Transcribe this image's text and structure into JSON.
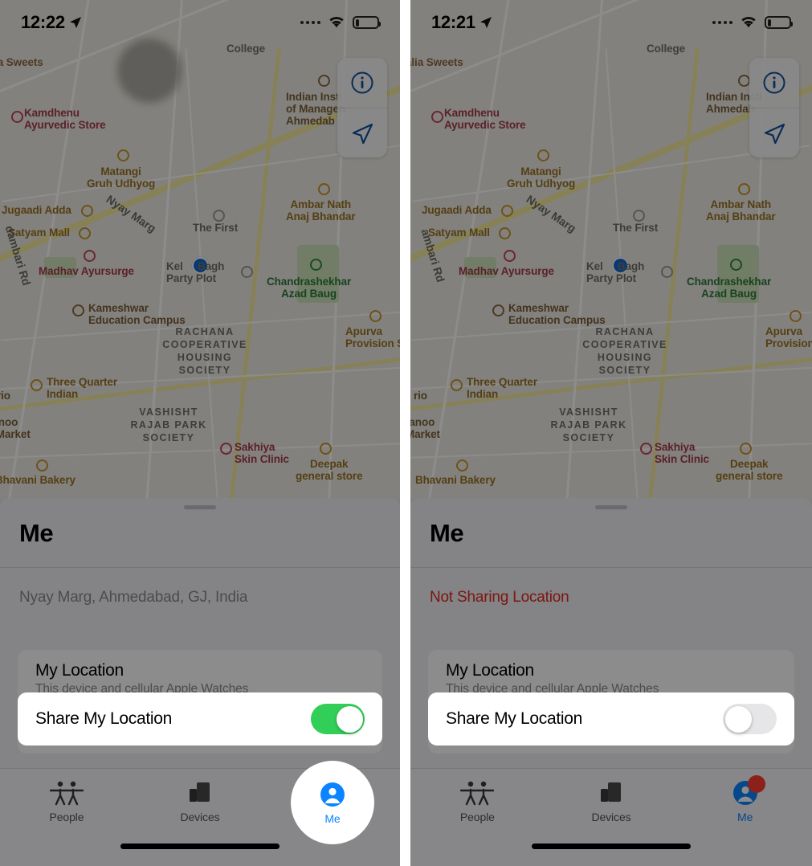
{
  "app": {
    "name": "Find My"
  },
  "panels": [
    {
      "id": "panel-sharing-on",
      "status_bar": {
        "time": "12:22",
        "location_icon": "location-arrow-icon",
        "cellular_icon": "cellular-dots-icon",
        "wifi_icon": "wifi-icon",
        "battery_icon": "battery-icon"
      },
      "map": {
        "info_button": "info-icon",
        "locate_button": "navigation-arrow-icon",
        "street": "Nyay Marg",
        "street2": "dambari Rd",
        "pois": [
          "alia Sweets",
          "Kamdhenu\nAyurvedic Store",
          "Matangi\nGruh Udhyog",
          "Jugaadi Adda",
          "Satyam Mall",
          "Madhav Ayursurge",
          "Kameshwar\nEducation Campus",
          "Three Quarter\nIndian",
          "tanoo\nr Market",
          "Bhavani Bakery",
          "rio",
          "College",
          "Indian Insti\nof Managen\nAhmedab",
          "The First",
          "Ambar Nath\nAnaj Bhandar",
          "Kel     Bagh\nParty Plot",
          "Chandrashekhar\nAzad Baug",
          "Apurva\nProvision Sto",
          "Sakhiya\nSkin Clinic",
          "Deepak\ngeneral store"
        ],
        "areas": [
          "RACHANA\nCOOPERATIVE\nHOUSING\nSOCIETY",
          "VASHISHT\nRAJAB PARK\nSOCIETY"
        ]
      },
      "sheet": {
        "title": "Me",
        "status": "Nyay Marg, Ahmedabad, GJ, India",
        "status_color": "#8b8b90",
        "card": {
          "title": "My Location",
          "subtitle": "This device and cellular Apple Watches"
        },
        "share_row": {
          "label": "Share My Location",
          "toggle_state": "on",
          "toggle_color": "#32cf58"
        }
      },
      "tabbar": {
        "tabs": [
          {
            "label": "People",
            "icon": "people-icon",
            "active": false
          },
          {
            "label": "Devices",
            "icon": "devices-icon",
            "active": false
          },
          {
            "label": "Me",
            "icon": "person-circle-icon",
            "active": true
          }
        ],
        "spotlight_on": "Me",
        "badge": false
      }
    },
    {
      "id": "panel-sharing-off",
      "status_bar": {
        "time": "12:21",
        "location_icon": "location-arrow-icon",
        "cellular_icon": "cellular-dots-icon",
        "wifi_icon": "wifi-icon",
        "battery_icon": "battery-icon"
      },
      "map": {
        "info_button": "info-icon",
        "locate_button": "navigation-arrow-icon",
        "street": "Nyay Marg",
        "street2": "ambari Rd",
        "pois": [
          "alia Sweets",
          "Kamdhenu\nAyurvedic Store",
          "Matangi\nGruh Udhyog",
          "Jugaadi Adda",
          "Satyam Mall",
          "Madhav Ayursurge",
          "Kameshwar\nEducation Campus",
          "Three Quarter\nIndian",
          "tanoo\nMarket",
          "Bhavani Bakery",
          "rio",
          "College",
          "Indian Insti\nAhmedab",
          "The First",
          "Ambar Nath\nAnaj Bhandar",
          "Kel     Bagh\nParty Plot",
          "Chandrashekhar\nAzad Baug",
          "Apurva\nProvision Sto",
          "Sakhiya\nSkin Clinic",
          "Deepak\ngeneral store"
        ],
        "areas": [
          "RACHANA\nCOOPERATIVE\nHOUSING\nSOCIETY",
          "VASHISHT\nRAJAB PARK\nSOCIETY"
        ]
      },
      "sheet": {
        "title": "Me",
        "status": "Not Sharing Location",
        "status_color": "#e02d1f",
        "card": {
          "title": "My Location",
          "subtitle": "This device and cellular Apple Watches"
        },
        "share_row": {
          "label": "Share My Location",
          "toggle_state": "off",
          "toggle_color": "#e6e6e8"
        }
      },
      "tabbar": {
        "tabs": [
          {
            "label": "People",
            "icon": "people-icon",
            "active": false
          },
          {
            "label": "Devices",
            "icon": "devices-icon",
            "active": false
          },
          {
            "label": "Me",
            "icon": "person-circle-icon",
            "active": true
          }
        ],
        "spotlight_on": null,
        "badge": true
      }
    }
  ]
}
